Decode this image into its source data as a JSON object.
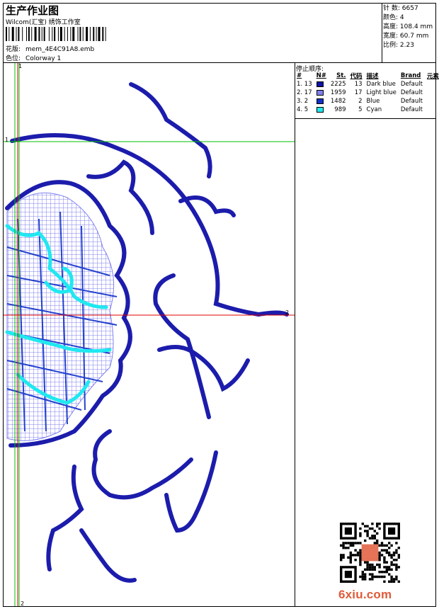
{
  "header": {
    "title": "生产作业图",
    "subtitle": "Wilcom(汇宝) 绣饰工作室",
    "design_label": "花版:",
    "design_value": "mem_4E4C91A8.emb",
    "colorway_label": "色位:",
    "colorway_value": "Colorway 1"
  },
  "stats": [
    {
      "label": "针 数:",
      "value": "6657"
    },
    {
      "label": "颜色:",
      "value": "4"
    },
    {
      "label": "高度:",
      "value": "108.4 mm"
    },
    {
      "label": "宽度:",
      "value": "60.7 mm"
    },
    {
      "label": "比例:",
      "value": "2.23"
    }
  ],
  "stop_sequence": {
    "title": "停止顺序:",
    "headers": [
      "#",
      "N#",
      "St.",
      "代码",
      "描述",
      "Brand",
      "元素"
    ],
    "rows": [
      {
        "idx": "1. 13",
        "stitches": "2225",
        "code": "13",
        "desc": "Dark blue",
        "brand": "Default",
        "color": "#1010a8"
      },
      {
        "idx": "2. 17",
        "stitches": "1959",
        "code": "17",
        "desc": "Light blue",
        "brand": "Default",
        "color": "#8080f0"
      },
      {
        "idx": "3. 2",
        "stitches": "1482",
        "code": "2",
        "desc": "Blue",
        "brand": "Default",
        "color": "#1030c8"
      },
      {
        "idx": "4. 5",
        "stitches": "989",
        "code": "5",
        "desc": "Cyan",
        "brand": "Default",
        "color": "#20e8f0"
      }
    ]
  },
  "guides": {
    "top_left": "1",
    "left_mark": "1",
    "bottom_mark": "2",
    "right_mark": "2"
  },
  "watermark": "6xiu.com",
  "colors": {
    "dark_blue": "#1010a8",
    "light_blue": "#8080f0",
    "blue": "#1030c8",
    "cyan": "#20e8f0",
    "guide_green": "#00c000",
    "guide_red": "#e00000",
    "watermark": "#e05a3a"
  }
}
